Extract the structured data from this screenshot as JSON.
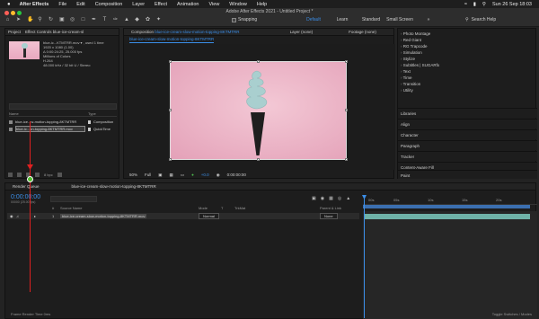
{
  "menubar": {
    "apple": "",
    "app_name": "After Effects",
    "items": [
      "File",
      "Edit",
      "Composition",
      "Layer",
      "Effect",
      "Animation",
      "View",
      "Window",
      "Help"
    ],
    "datetime": "Sun 26 Sep  18:03"
  },
  "titlebar": {
    "title": "Adobe After Effects 2021 - Untitled Project *",
    "snapping_label": "Snapping",
    "workspaces": [
      "Default",
      "Learn",
      "Standard",
      "Small Screen"
    ],
    "active_workspace": "Default",
    "search_help": "Search Help"
  },
  "project_panel": {
    "tab_project": "Project",
    "tab_effect_controls": "Effect Controls blue-ice-cream-sl",
    "info_lines": [
      "blue-ic...KTMTRR.mov ▾ , used 1 time",
      "1920 x 1080 (1.00)",
      "Δ 0:00:24:25, 25.000 fps",
      "Millions of Colors",
      "H.264",
      "48.000 kHz / 32 bit U / Stereo"
    ],
    "columns": [
      "Name",
      "Type"
    ],
    "files": [
      {
        "name": "blue-ice...w-motion-topping-8KTMTRR",
        "type": "Composition"
      },
      {
        "name": "blue-ic...on-topping-8KTMTRR.mov",
        "type": "QuickTime"
      }
    ],
    "bpc": "8 bpc"
  },
  "composition_panel": {
    "tab_composition": "Composition",
    "comp_name": "blue-ice-cream-slow-motion-topping-8KTMTRR",
    "tab_layer": "Layer (none)",
    "tab_footage": "Footage (none)",
    "subtab": "blue-ice-cream-slow-motion-topping-8KTMTRR",
    "zoom": "50%",
    "resolution": "Full",
    "exposure": "+0.0",
    "timecode": "0:00:00:00"
  },
  "right_panel": {
    "effects": [
      "Photo Montage",
      "Red Giant",
      "RG Trapcode",
      "Simulation",
      "Stylize",
      "Subtitles | SUGARfx",
      "Text",
      "Time",
      "Transition",
      "Utility"
    ],
    "sections": [
      "Libraries",
      "Align",
      "Character",
      "Paragraph",
      "Tracker",
      "Content-Aware Fill",
      "Paint"
    ]
  },
  "timeline_panel": {
    "tab_render_queue": "Render Queue",
    "tab_comp": "blue-ice-cream-slow-motion-topping-8KTMTRR",
    "timecode": "0:00:00:00",
    "fps_info": "00000 (25.00 fps)",
    "columns": [
      "#",
      "Source Name",
      "Mode",
      "T",
      "TrkMat",
      "Parent & Link"
    ],
    "ruler_ticks": [
      "00s",
      "05s",
      "10s",
      "15s",
      "20s"
    ],
    "layer": {
      "number": "1",
      "source_name": "blue-ice-cream-slow-motion-topping-8KTMTRR.mov",
      "mode": "Normal",
      "parent": "None"
    },
    "footer_left": "Frame Render Time 0ms",
    "footer_right": "Toggle Switches / Modes"
  },
  "colors": {
    "accent_blue": "#3b8ee8",
    "annotation_red": "#e02020",
    "layer_bar": "#6fb2a8"
  }
}
